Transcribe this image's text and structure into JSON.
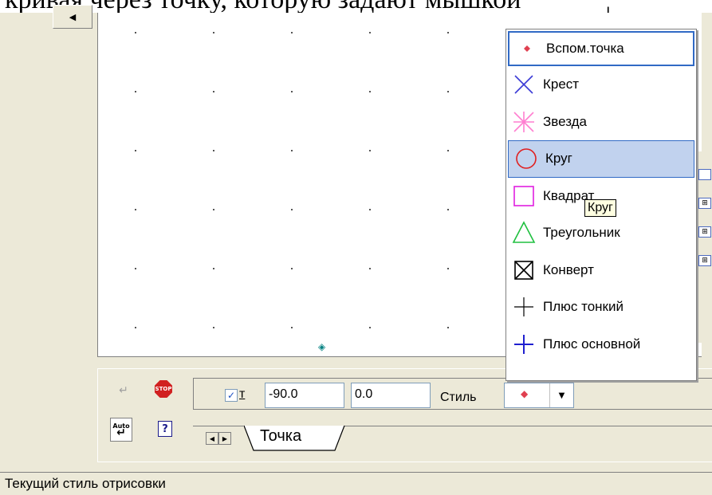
{
  "top_caption": "кривая через точку, которую задают мышкой",
  "status": {
    "text": "Текущий стиль отрисовки"
  },
  "panel": {
    "angle_value": "-90.0",
    "second_value": "0.0",
    "t_label": "т",
    "style_label": "Стиль",
    "tab_label": "Точка",
    "stop_label": "STOP",
    "auto_label_top": "Auto",
    "auto_label_bottom": "↵",
    "help_label": "?"
  },
  "menu": {
    "items": [
      {
        "label": "Вспом.точка",
        "icon": "aux-point-icon",
        "color": "#e04050",
        "state": "selected"
      },
      {
        "label": "Крест",
        "icon": "cross-icon",
        "color": "#3b3bd6",
        "state": ""
      },
      {
        "label": "Звезда",
        "icon": "star-icon",
        "color": "#ff7fd0",
        "state": ""
      },
      {
        "label": "Круг",
        "icon": "circle-icon",
        "color": "#e02020",
        "state": "hover"
      },
      {
        "label": "Квадрат",
        "icon": "square-icon",
        "color": "#e020e0",
        "state": ""
      },
      {
        "label": "Треугольник",
        "icon": "triangle-icon",
        "color": "#20c040",
        "state": ""
      },
      {
        "label": "Конверт",
        "icon": "envelope-icon",
        "color": "#000000",
        "state": ""
      },
      {
        "label": "Плюс тонкий",
        "icon": "plus-thin-icon",
        "color": "#000000",
        "state": ""
      },
      {
        "label": "Плюс основной",
        "icon": "plus-main-icon",
        "color": "#2020d0",
        "state": ""
      }
    ]
  },
  "tooltip": "Круг",
  "colors": {
    "accent": "#316ac5",
    "hover": "#c1d2ee",
    "stop": "#d12020"
  }
}
